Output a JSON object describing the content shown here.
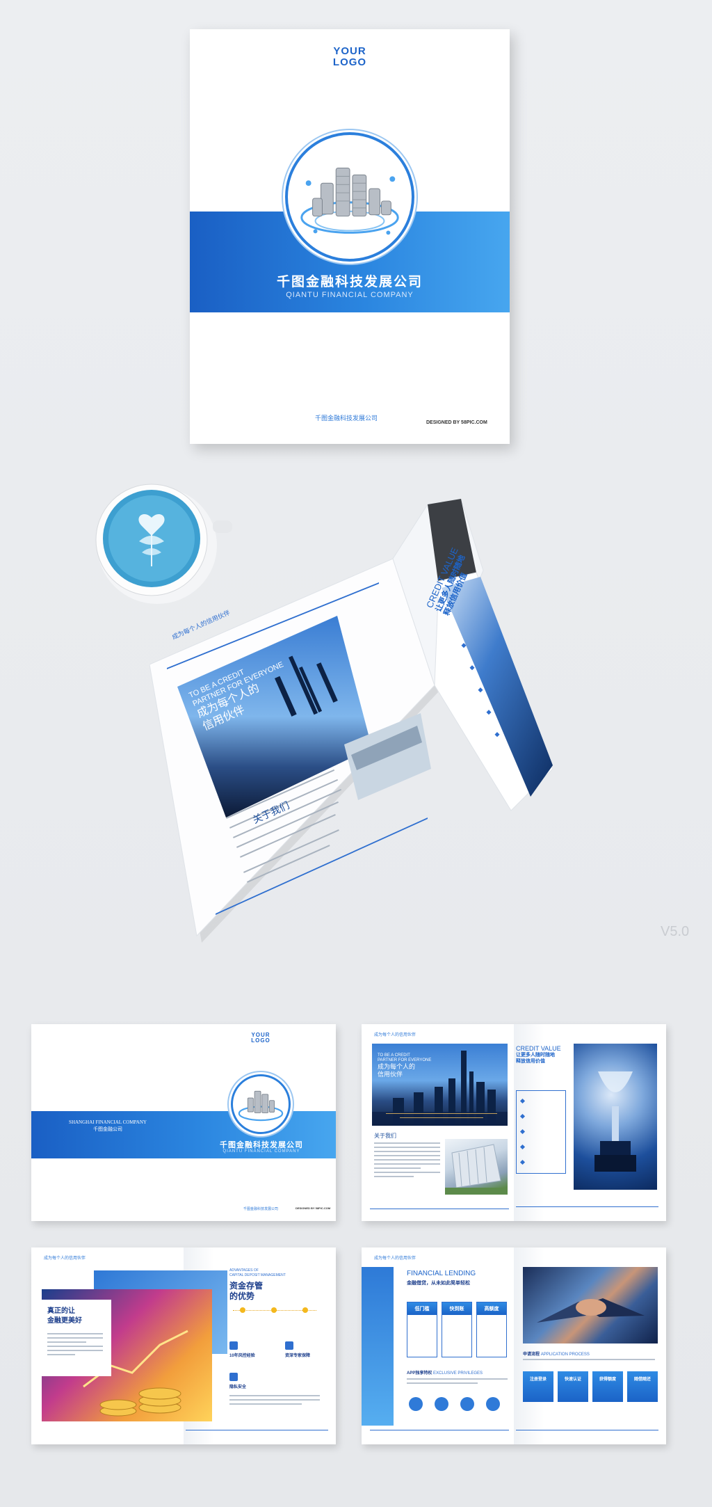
{
  "cover": {
    "logo_line1": "YOUR",
    "logo_line2": "LOGO",
    "title_cn": "千图金融科技发展公司",
    "title_en": "QIANTU FINANCIAL COMPANY",
    "footer_cn": "千图金融科技发展公司",
    "designed_by": "DESIGNED BY 58PIC.COM"
  },
  "magazine": {
    "header_cn": "成为每个人的信用伙伴",
    "hero_en_line1": "TO BE A CREDIT",
    "hero_en_line2": "PARTNER FOR EVERYONE",
    "hero_cn_line1": "成为每个人的",
    "hero_cn_line2": "信用伙伴",
    "about": "关于我们",
    "credit_en": "CREDIT VALUE",
    "credit_cn_line1": "让更多人随时随地",
    "credit_cn_line2": "释放信用价值"
  },
  "version": "V5.0",
  "thumb_cover": {
    "logo_line1": "YOUR",
    "logo_line2": "LOGO",
    "company_en": "SHANGHAI FINANCIAL COMPANY",
    "company_cn": "千图金融公司",
    "title_cn": "千图金融科技发展公司",
    "title_en": "QIANTU FINANCIAL COMPANY",
    "footer_cn": "千图金融科技发展公司",
    "designed_by": "DESIGNED BY 58PIC.COM"
  },
  "thumb_credit": {
    "header_cn": "成为每个人的信用伙伴",
    "hero_en_line1": "TO BE A CREDIT",
    "hero_en_line2": "PARTNER FOR EVERYONE",
    "hero_cn_line1": "成为每个人的",
    "hero_cn_line2": "信用伙伴",
    "about": "关于我们",
    "credit_en": "CREDIT VALUE",
    "credit_cn_line1": "让更多人随时随地",
    "credit_cn_line2": "释放信用价值"
  },
  "thumb_deposit": {
    "header_cn": "成为每个人的信用伙伴",
    "adv_en_line1": "ADVANTAGES OF",
    "adv_en_line2": "CAPITAL DEPOSIT MANAGEMENT",
    "adv_cn_line1": "资金存管",
    "adv_cn_line2": "的优势",
    "slogan_line1": "真正的让",
    "slogan_line2": "金融更美好",
    "feature1": "10年风控经验",
    "feature2": "资深专家保障",
    "feature3": "隐私安全"
  },
  "thumb_lending": {
    "header_cn": "成为每个人的信用伙伴",
    "lend_en": "FINANCIAL LENDING",
    "lend_cn": "金融借贷，从未如此简单轻松",
    "card1": "低门槛",
    "card2": "快到账",
    "card3": "高额度",
    "privilege_cn": "APP独享特权",
    "privilege_en": "EXCLUSIVE PRIVILEGES",
    "process_cn": "申请流程",
    "process_en": "APPLICATION PROCESS",
    "step1": "注册登录",
    "step2": "快速认证",
    "step3": "获得额度",
    "step4": "随借随还"
  },
  "colors": {
    "brand_blue": "#1d64c9",
    "light_blue": "#47a6ef",
    "background": "#eaecef"
  }
}
